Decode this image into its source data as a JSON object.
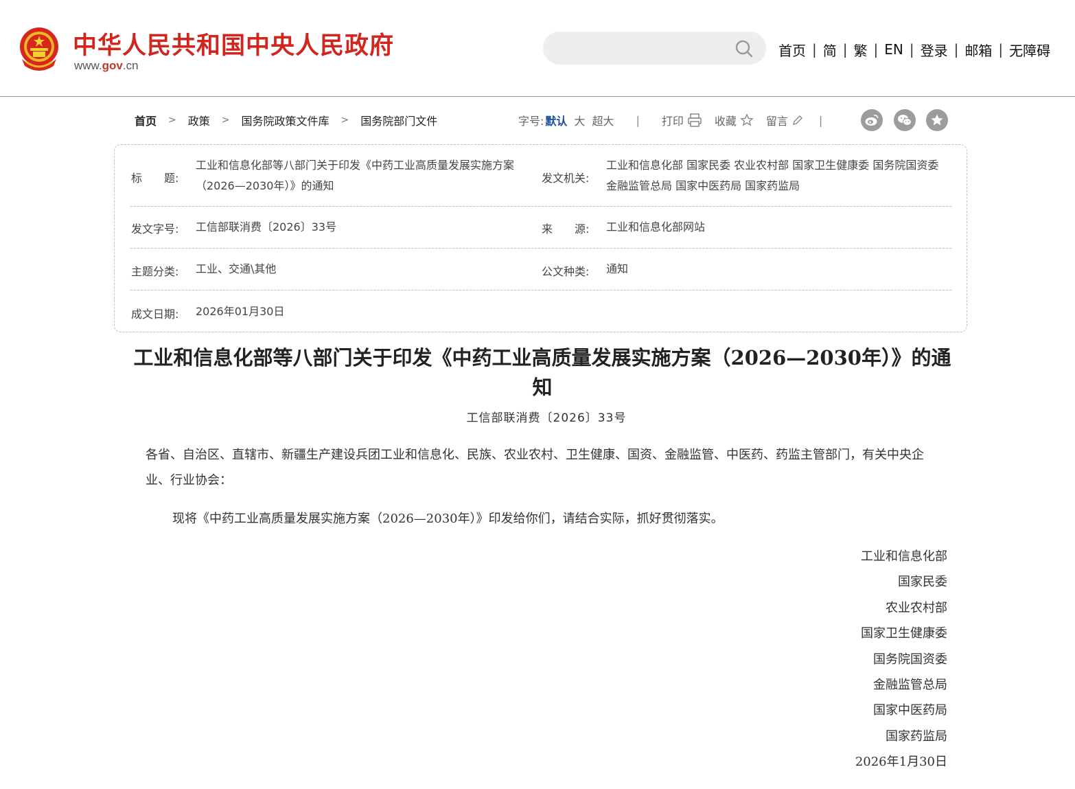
{
  "header": {
    "site_title": "中华人民共和国中央人民政府",
    "site_url_prefix": "www.",
    "site_url_gov": "gov",
    "site_url_suffix": ".cn",
    "search_placeholder": "",
    "nav": [
      "首页",
      "简",
      "繁",
      "EN",
      "登录",
      "邮箱",
      "无障碍"
    ],
    "nav_separator": "|"
  },
  "breadcrumb": {
    "items": [
      "首页",
      "政策",
      "国务院政策文件库",
      "国务院部门文件"
    ],
    "arrow": ">"
  },
  "tools": {
    "font_size_label": "字号:",
    "font_default": "默认",
    "font_large": "大",
    "font_xlarge": "超大",
    "divider": "|",
    "print": "打印",
    "favorite": "收藏",
    "comment": "留言"
  },
  "info": {
    "title_label": "标　　题:",
    "title_value": "工业和信息化部等八部门关于印发《中药工业高质量发展实施方案（2026—2030年）》的通知",
    "issuer_label": "发文机关:",
    "issuer_value": "工业和信息化部 国家民委 农业农村部 国家卫生健康委 国务院国资委 金融监管总局 国家中医药局 国家药监局",
    "docno_label": "发文字号:",
    "docno_value": "工信部联消费〔2026〕33号",
    "source_label": "来　　源:",
    "source_value": "工业和信息化部网站",
    "topic_label": "主题分类:",
    "topic_value": "工业、交通\\其他",
    "doctype_label": "公文种类:",
    "doctype_value": "通知",
    "date_label": "成文日期:",
    "date_value": "2026年01月30日"
  },
  "article": {
    "title": "工业和信息化部等八部门关于印发《中药工业高质量发展实施方案（2026—2030年）》的通知",
    "doc_number": "工信部联消费〔2026〕33号",
    "addressee": "各省、自治区、直辖市、新疆生产建设兵团工业和信息化、民族、农业农村、卫生健康、国资、金融监管、中医药、药监主管部门，有关中央企业、行业协会：",
    "body": "现将《中药工业高质量发展实施方案（2026—2030年）》印发给你们，请结合实际，抓好贯彻落实。",
    "signatures": [
      "工业和信息化部",
      "国家民委",
      "农业农村部",
      "国家卫生健康委",
      "国务院国资委",
      "金融监管总局",
      "国家中医药局",
      "国家药监局"
    ],
    "date": "2026年1月30日"
  },
  "colors": {
    "brand_red": "#d1261e",
    "link_blue": "#1b4f9c",
    "share_icon_gray": "#9c9c9c"
  },
  "icons": [
    "national-emblem",
    "search-icon",
    "printer-icon",
    "star-icon",
    "pencil-icon",
    "weibo-icon",
    "wechat-icon",
    "favorite-star-icon"
  ]
}
